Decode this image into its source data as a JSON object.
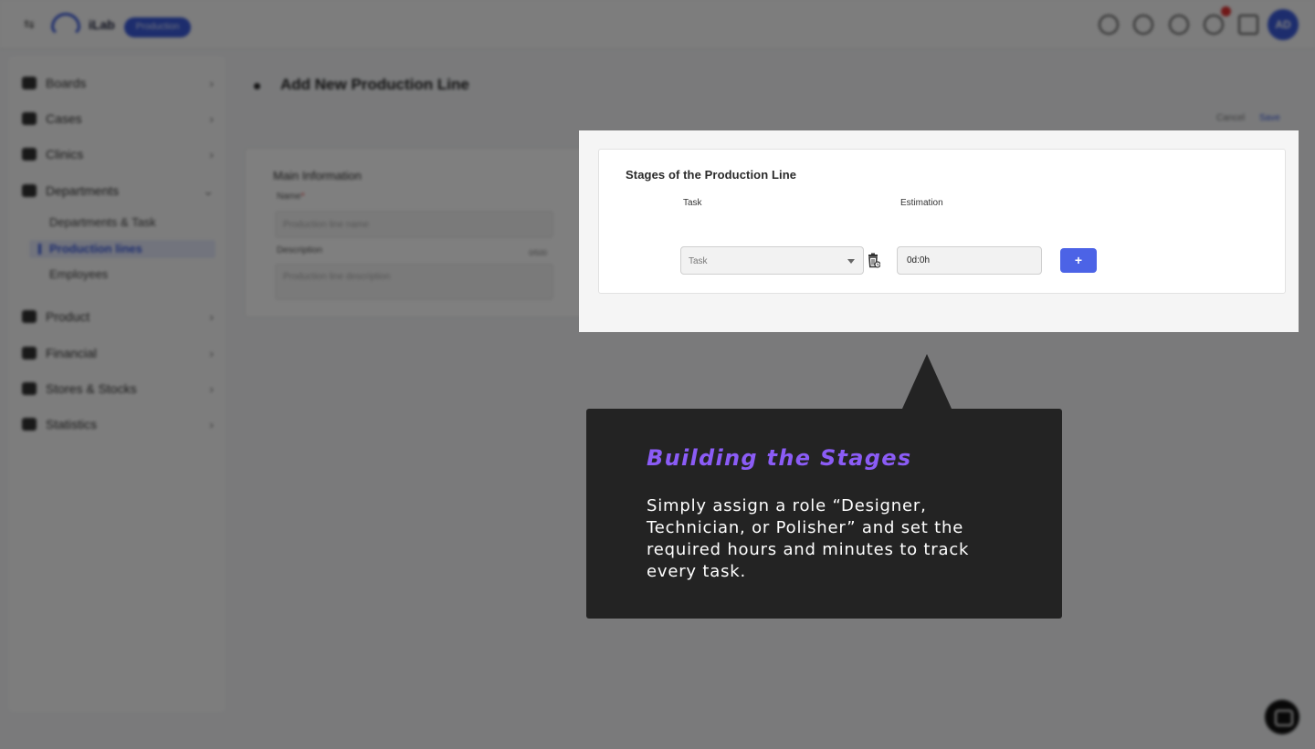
{
  "topbar": {
    "app_name": "iLab",
    "env_badge": "Production",
    "avatar_initials": "AD"
  },
  "sidebar": {
    "items": [
      {
        "label": "Boards"
      },
      {
        "label": "Cases"
      },
      {
        "label": "Clinics"
      },
      {
        "label": "Departments"
      },
      {
        "label": "Product"
      },
      {
        "label": "Financial"
      },
      {
        "label": "Stores & Stocks"
      },
      {
        "label": "Statistics"
      }
    ],
    "department_subitems": [
      {
        "label": "Departments & Task"
      },
      {
        "label": "Production lines"
      },
      {
        "label": "Employees"
      }
    ]
  },
  "page": {
    "title": "Add New Production Line",
    "cancel_label": "Cancel",
    "save_label": "Save"
  },
  "main_info": {
    "title": "Main Information",
    "name_label": "Name",
    "name_required": "*",
    "name_placeholder": "Production line name",
    "description_label": "Description",
    "description_count": "0/500",
    "description_placeholder": "Production line description"
  },
  "stages": {
    "title": "Stages of the Production Line",
    "col_task": "Task",
    "col_estimation": "Estimation",
    "task_placeholder": "Task",
    "estimation_value": "0d:0h",
    "add_label": "+"
  },
  "tooltip": {
    "title": "Building the Stages",
    "body": "Simply assign a role “Designer, Technician, or Polisher” and set the required hours and minutes to track every task."
  },
  "colors": {
    "accent": "#4c63e6",
    "tooltip_bg": "#232323",
    "tooltip_title": "#8b5cf6"
  }
}
